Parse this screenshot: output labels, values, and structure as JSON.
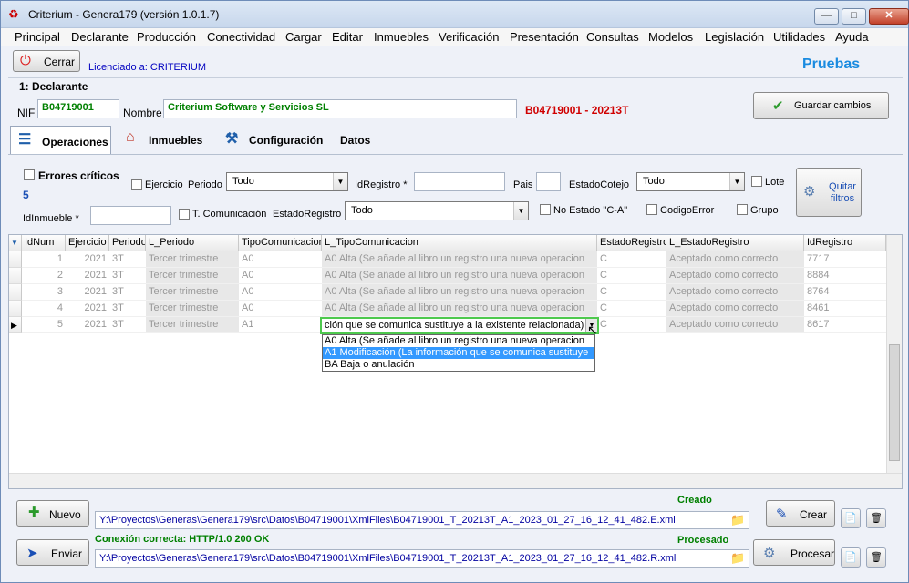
{
  "window": {
    "title": "Criterium - Genera179 (versión 1.0.1.7)",
    "min": "—",
    "max": "□",
    "close": "✕"
  },
  "menu": [
    "Principal",
    "Declarante",
    "Producción",
    "Conectividad",
    "Cargar",
    "Editar",
    "Inmuebles",
    "Verificación",
    "Presentación",
    "Consultas",
    "Modelos",
    "Legislación",
    "Utilidades",
    "Ayuda"
  ],
  "toolbar": {
    "close_label": "Cerrar",
    "licensed": "Licenciado a: CRITERIUM",
    "env": "Pruebas"
  },
  "declarante": {
    "section": "1: Declarante",
    "nif_label": "NIF",
    "nif": "B04719001",
    "nombre_label": "Nombre",
    "nombre": "Criterium Software y Servicios SL",
    "code": "B04719001 - 20213T",
    "save": "Guardar cambios"
  },
  "tabs": [
    "Operaciones",
    "Inmuebles",
    "Configuración",
    "Datos"
  ],
  "filters": {
    "errores": "Errores críticos",
    "errores_count": "5",
    "ejercicio": "Ejercicio",
    "periodo": "Periodo",
    "periodo_val": "Todo",
    "idregistro": "IdRegistro *",
    "pais": "Pais",
    "estadocotejo": "EstadoCotejo",
    "estadocotejo_val": "Todo",
    "lote": "Lote",
    "quitar": "Quitar filtros",
    "idinmueble": "IdInmueble *",
    "tcom": "T. Comunicación",
    "estadoregistro": "EstadoRegistro",
    "estadoregistro_val": "Todo",
    "noestado": "No Estado \"C-A\"",
    "codigoerror": "CodigoError",
    "grupo": "Grupo"
  },
  "grid": {
    "headers": [
      "IdNum",
      "Ejercicio",
      "Periodo",
      "L_Periodo",
      "TipoComunicacion",
      "L_TipoComunicacion",
      "EstadoRegistro",
      "L_EstadoRegistro",
      "IdRegistro"
    ],
    "rows": [
      [
        "1",
        "2021",
        "3T",
        "Tercer trimestre",
        "A0",
        "A0 Alta (Se añade al libro un registro una nueva operacion",
        "C",
        "Aceptado como correcto",
        "7717"
      ],
      [
        "2",
        "2021",
        "3T",
        "Tercer trimestre",
        "A0",
        "A0 Alta (Se añade al libro un registro una nueva operacion",
        "C",
        "Aceptado como correcto",
        "8884"
      ],
      [
        "3",
        "2021",
        "3T",
        "Tercer trimestre",
        "A0",
        "A0 Alta (Se añade al libro un registro una nueva operacion",
        "C",
        "Aceptado como correcto",
        "8764"
      ],
      [
        "4",
        "2021",
        "3T",
        "Tercer trimestre",
        "A0",
        "A0 Alta (Se añade al libro un registro una nueva operacion",
        "C",
        "Aceptado como correcto",
        "8461"
      ],
      [
        "5",
        "2021",
        "3T",
        "Tercer trimestre",
        "A1",
        "",
        "C",
        "Aceptado como correcto",
        "8617"
      ]
    ],
    "editing": "ción que se comunica sustituye a la existente relacionada)",
    "dropdown": [
      "A0 Alta (Se añade al libro un registro una nueva operacion",
      "A1 Modificación (La información que se comunica sustituye",
      "BA Baja o anulación"
    ]
  },
  "bottom": {
    "nuevo": "Nuevo",
    "creado": "Creado",
    "path1": "Y:\\Proyectos\\Generas\\Genera179\\src\\Datos\\B04719001\\XmlFiles\\B04719001_T_20213T_A1_2023_01_27_16_12_41_482.E.xml",
    "crear": "Crear",
    "enviar": "Enviar",
    "conexion": "Conexión correcta: HTTP/1.0 200 OK",
    "procesado": "Procesado",
    "path2": "Y:\\Proyectos\\Generas\\Genera179\\src\\Datos\\B04719001\\XmlFiles\\B04719001_T_20213T_A1_2023_01_27_16_12_41_482.R.xml",
    "procesar": "Procesar"
  }
}
